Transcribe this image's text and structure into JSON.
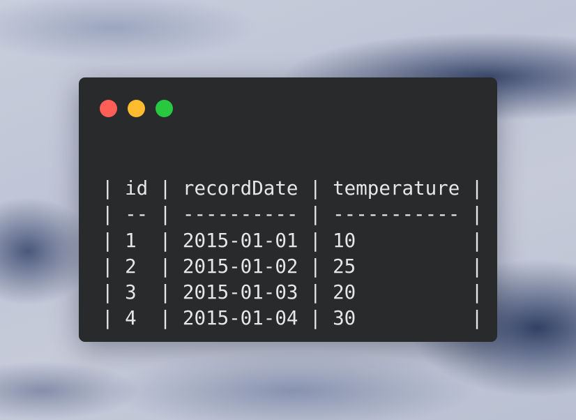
{
  "window_controls": {
    "close_color": "#ff5f57",
    "minimize_color": "#febc2e",
    "maximize_color": "#28c840"
  },
  "code": {
    "lines": [
      "| id | recordDate | temperature |",
      "| -- | ---------- | ----------- |",
      "| 1  | 2015-01-01 | 10          |",
      "| 2  | 2015-01-02 | 25          |",
      "| 3  | 2015-01-03 | 20          |",
      "| 4  | 2015-01-04 | 30          |"
    ]
  }
}
